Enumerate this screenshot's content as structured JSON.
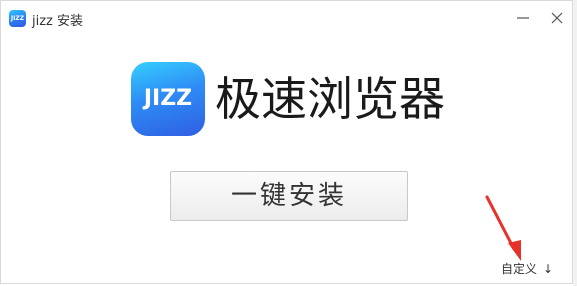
{
  "window": {
    "app_icon_text": "JIZZ",
    "title": "jizz 安装",
    "minimize_icon": "minimize-icon",
    "close_icon": "close-icon"
  },
  "brand": {
    "logo_text": "JIZZ",
    "product_name": "极速浏览器"
  },
  "actions": {
    "install_label": "一键安装",
    "custom_label": "自定义",
    "custom_arrow": "↓"
  },
  "annotation": {
    "arrow_icon": "red-arrow-icon",
    "color": "#e8312a"
  },
  "colors": {
    "brand_gradient_start": "#35cfff",
    "brand_gradient_end": "#2f5fe3",
    "button_border": "#c8c8c8"
  }
}
